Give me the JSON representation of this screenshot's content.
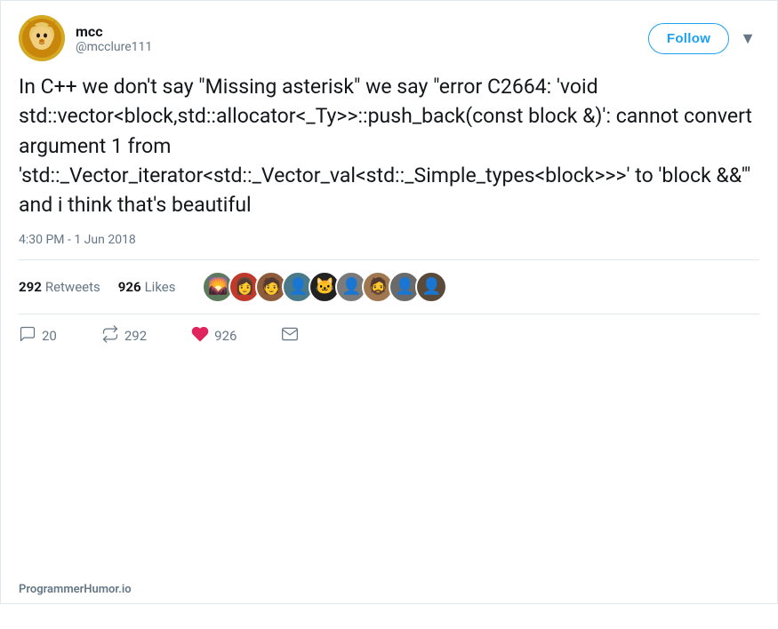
{
  "tweet": {
    "user": {
      "name": "mcc",
      "handle": "@mcclure111"
    },
    "follow_label": "Follow",
    "chevron": "▾",
    "text": "In C++ we don't say \"Missing asterisk\" we say \"error C2664: 'void std::vector<block,std::allocator<_Ty>>::push_back(const block &)': cannot convert argument 1 from 'std::_Vector_iterator<std::_Vector_val<std::_Simple_types<block>>>' to 'block &&'\" and i think that's beautiful",
    "timestamp": "4:30 PM - 1 Jun 2018",
    "stats": {
      "retweet_count": "292",
      "retweet_label": "Retweets",
      "likes_count": "926",
      "likes_label": "Likes"
    },
    "actions": {
      "comment_count": "20",
      "retweet_count": "292",
      "heart_count": "926"
    }
  },
  "footer": {
    "brand": "ProgrammerHumor.io"
  }
}
